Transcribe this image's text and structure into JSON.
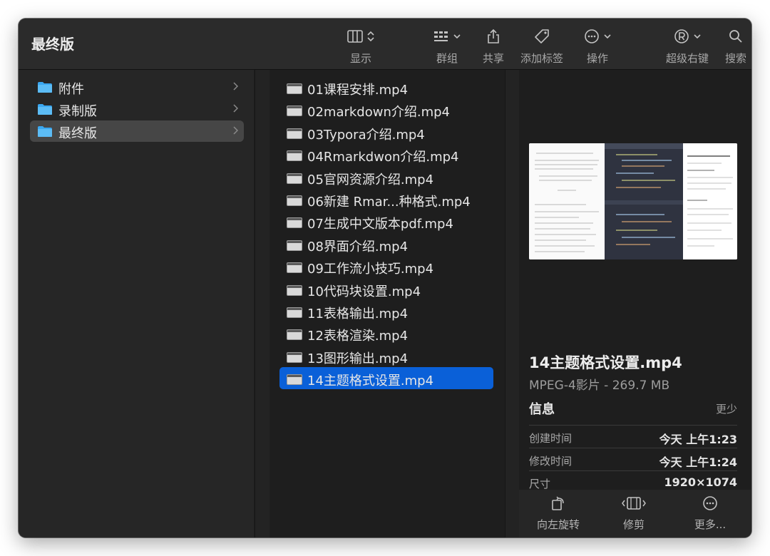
{
  "window": {
    "title": "最终版"
  },
  "toolbar": {
    "items": [
      {
        "label": "显示"
      },
      {
        "label": "群组"
      },
      {
        "label": "共享"
      },
      {
        "label": "添加标签"
      },
      {
        "label": "操作"
      },
      {
        "label": "超级右键"
      },
      {
        "label": "搜索"
      }
    ]
  },
  "sidebar": {
    "items": [
      {
        "label": "附件"
      },
      {
        "label": "录制版"
      },
      {
        "label": "最终版"
      }
    ]
  },
  "files": [
    {
      "name": "01课程安排.mp4"
    },
    {
      "name": "02markdown介绍.mp4"
    },
    {
      "name": "03Typora介绍.mp4"
    },
    {
      "name": "04Rmarkdwon介绍.mp4"
    },
    {
      "name": "05官网资源介绍.mp4"
    },
    {
      "name": "06新建 Rmar...种格式.mp4"
    },
    {
      "name": "07生成中文版本pdf.mp4"
    },
    {
      "name": "08界面介绍.mp4"
    },
    {
      "name": "09工作流小技巧.mp4"
    },
    {
      "name": "10代码块设置.mp4"
    },
    {
      "name": "11表格输出.mp4"
    },
    {
      "name": "12表格渲染.mp4"
    },
    {
      "name": "13图形输出.mp4"
    },
    {
      "name": "14主题格式设置.mp4"
    }
  ],
  "preview": {
    "title": "14主题格式设置.mp4",
    "subtitle": "MPEG-4影片 - 269.7 MB",
    "info_label": "信息",
    "more_label": "更少",
    "rows": [
      {
        "key": "创建时间",
        "value": "今天 上午1:23"
      },
      {
        "key": "修改时间",
        "value": "今天 上午1:24"
      },
      {
        "key": "尺寸",
        "value": "1920×1074"
      }
    ],
    "actions": [
      {
        "label": "向左旋转"
      },
      {
        "label": "修剪"
      },
      {
        "label": "更多..."
      }
    ]
  },
  "colors": {
    "selection": "#0a60d8",
    "folder": "#3aa7f0",
    "window_bg": "#1e1e1e"
  }
}
